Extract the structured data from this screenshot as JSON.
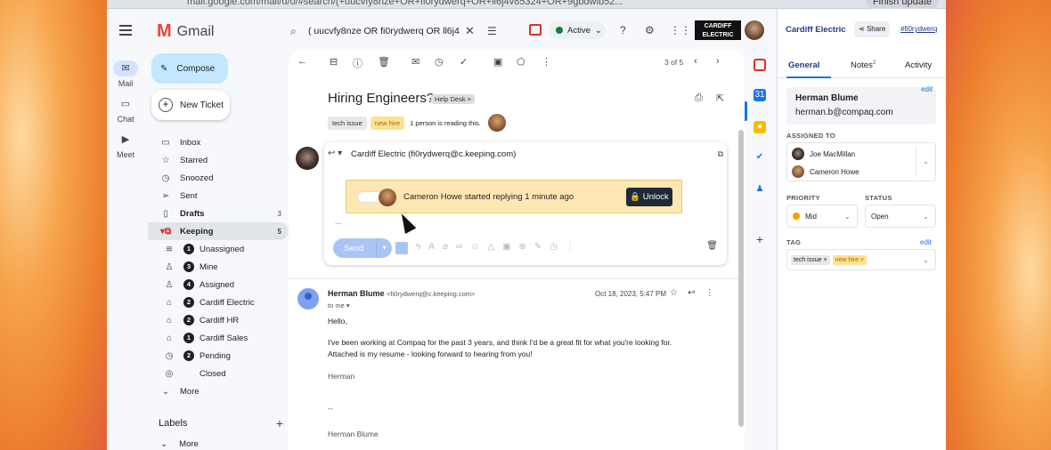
{
  "browser": {
    "url_fragment": "mail.google.com/mail/u/0/#search/(+uucvfy8nze+OR+fi0rydwerq+OR+ll6j4v85324+OR+9gbdwib52...",
    "finish_update": "Finish update"
  },
  "app": {
    "name": "Gmail",
    "logo_letter": "M"
  },
  "rail": {
    "items": [
      {
        "label": "Mail",
        "icon": "mail-icon"
      },
      {
        "label": "Chat",
        "icon": "chat-icon"
      },
      {
        "label": "Meet",
        "icon": "meet-icon"
      }
    ]
  },
  "compose_label": "Compose",
  "new_ticket_label": "New Ticket",
  "nav": {
    "inbox": "Inbox",
    "starred": "Starred",
    "snoozed": "Snoozed",
    "sent": "Sent",
    "drafts": {
      "label": "Drafts",
      "count": "3"
    },
    "keeping": {
      "label": "Keeping",
      "count": "5"
    },
    "sub": [
      {
        "label": "Unassigned",
        "num": "1"
      },
      {
        "label": "Mine",
        "num": "3"
      },
      {
        "label": "Assigned",
        "num": "4"
      },
      {
        "label": "Cardiff Electric",
        "num": "2"
      },
      {
        "label": "Cardiff HR",
        "num": "2"
      },
      {
        "label": "Cardiff Sales",
        "num": "1"
      },
      {
        "label": "Pending",
        "num": "2"
      },
      {
        "label": "Closed",
        "num": ""
      }
    ],
    "more": "More",
    "labels_header": "Labels",
    "more2": "More"
  },
  "search": {
    "query": "( uucvfy8nze OR  fi0rydwerq OR  ll6j4"
  },
  "status": {
    "label": "Active",
    "color": "#188038"
  },
  "brand_text": "CARDIFF ELECTRIC",
  "thread": {
    "pager": "3 of 5",
    "subject": "Hiring Engineers?",
    "helpdesk_label": "Help Desk ×",
    "tags": [
      "tech issue",
      "new hire"
    ],
    "reading_text": "1 person is reading this."
  },
  "reply": {
    "from": "Cardiff Electric (fi0rydwerq@c.keeping.com)",
    "lock_message": "Cameron Howe started replying 1 minute ago",
    "unlock_label": "Unlock",
    "send_label": "Send",
    "ellipsis": "..."
  },
  "message": {
    "sender_name": "Herman Blume",
    "sender_addr": "<fi0rydwerq@c.keeping.com>",
    "to": "to me",
    "date": "Oct 18, 2023, 5:47 PM",
    "greeting": "Hello,",
    "para1": "I've been working at Compaq for the past 3 years, and think I'd be a great fit for what you're looking for. Attached is my resume - looking forward to hearing from you!",
    "signoff": "Herman",
    "sigdash": "--",
    "signature": "Herman Blume"
  },
  "panel": {
    "title": "Cardiff Electric",
    "share_label": "Share",
    "hash": "#fi0rydwerq",
    "tabs": {
      "general": "General",
      "notes": "Notes",
      "notes_count": "2",
      "activity": "Activity"
    },
    "contact": {
      "name": "Herman Blume",
      "email": "herman.b@compaq.com",
      "edit": "edit"
    },
    "assigned_label": "ASSIGNED TO",
    "assignees": [
      "Joe MacMillan",
      "Cameron Howe"
    ],
    "priority_label": "PRIORITY",
    "priority_value": "Mid",
    "status_label": "STATUS",
    "status_value": "Open",
    "tag_label": "TAG",
    "tag_edit": "edit",
    "tags": [
      "tech issue ×",
      "new hire ×"
    ]
  }
}
